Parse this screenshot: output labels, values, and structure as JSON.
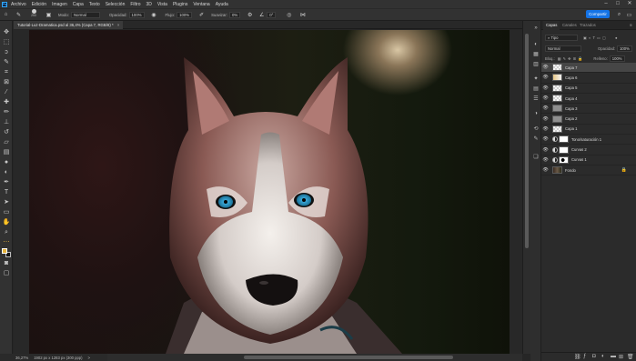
{
  "menubar": {
    "app_logo": "Ps",
    "items": [
      "Archivo",
      "Edición",
      "Imagen",
      "Capa",
      "Texto",
      "Selección",
      "Filtro",
      "3D",
      "Vista",
      "Plugins",
      "Ventana",
      "Ayuda"
    ],
    "controls": [
      "–",
      "□",
      "✕"
    ]
  },
  "options": {
    "brush_size": "250",
    "mode_label": "Modo:",
    "mode_value": "Normal",
    "opacity_label": "Opacidad:",
    "opacity_value": "100%",
    "flow_label": "Flujo:",
    "flow_value": "100%",
    "smoothing_label": "Suavizar:",
    "smoothing_value": "0%",
    "angle_value": "0°",
    "share_label": "Compartir"
  },
  "document": {
    "tab_title": "Tutorial-Luz-Dramatica.psd al 36,4% (Capa 7, RGB/8) *",
    "tab_close": "×"
  },
  "status": {
    "zoom": "36,27%",
    "doc_info": "1902 px x 1283 px (300 ppp)",
    "arrow": ">"
  },
  "layers_panel": {
    "tabs": [
      "Capas",
      "Canales",
      "Trazados"
    ],
    "filter_label": "Tipo",
    "blend_mode": "Normal",
    "opacity_label": "Opacidad:",
    "opacity_value": "100%",
    "lock_label": "Bloq.:",
    "fill_label": "Relleno:",
    "fill_value": "100%",
    "layers": [
      {
        "name": "Capa 7",
        "selected": true,
        "type": "pixel"
      },
      {
        "name": "Capa 6",
        "selected": false,
        "type": "pixel"
      },
      {
        "name": "Capa 5",
        "selected": false,
        "type": "pixel"
      },
      {
        "name": "Capa 4",
        "selected": false,
        "type": "pixel"
      },
      {
        "name": "Capa 3",
        "selected": false,
        "type": "pixel"
      },
      {
        "name": "Capa 2",
        "selected": false,
        "type": "pixel"
      },
      {
        "name": "Capa 1",
        "selected": false,
        "type": "pixel"
      },
      {
        "name": "Tono/saturación 1",
        "selected": false,
        "type": "adjustment"
      },
      {
        "name": "Curvas 2",
        "selected": false,
        "type": "adjustment"
      },
      {
        "name": "Curvas 1",
        "selected": false,
        "type": "adjustment"
      },
      {
        "name": "Fondo",
        "selected": false,
        "type": "background"
      }
    ]
  },
  "colors": {
    "accent": "#1473e6",
    "foreground_swatch": "#e7b33a",
    "background_swatch": "#151515"
  }
}
